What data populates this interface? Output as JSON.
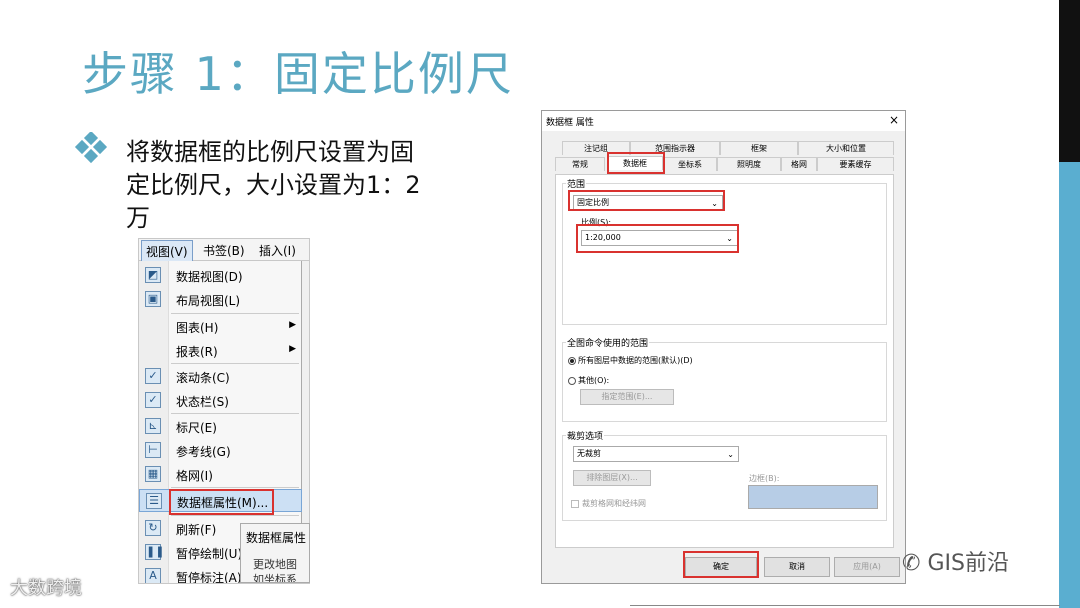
{
  "slide": {
    "title": "步骤 1：固定比例尺",
    "bullet": "将数据框的比例尺设置为固定比例尺，大小设置为1：2万"
  },
  "menu": {
    "menubar": [
      "视图(V)",
      "书签(B)",
      "插入(I)"
    ],
    "items": [
      {
        "label": "数据视图(D)",
        "icon": "data-view-icon"
      },
      {
        "label": "布局视图(L)",
        "icon": "layout-view-icon"
      },
      {
        "label": "图表(H)",
        "has_submenu": true
      },
      {
        "label": "报表(R)",
        "has_submenu": true
      },
      {
        "label": "滚动条(C)",
        "checked": true
      },
      {
        "label": "状态栏(S)",
        "checked": true
      },
      {
        "label": "标尺(E)",
        "icon": "ruler-icon"
      },
      {
        "label": "参考线(G)",
        "icon": "guide-icon"
      },
      {
        "label": "格网(I)",
        "icon": "grid-icon"
      },
      {
        "label": "数据框属性(M)...",
        "icon": "data-frame-properties-icon",
        "highlighted": true
      },
      {
        "label": "刷新(F)",
        "icon": "refresh-icon"
      },
      {
        "label": "暂停绘制(U)",
        "icon": "pause-icon"
      },
      {
        "label": "暂停标注(A)",
        "icon": "pause-label-icon"
      }
    ],
    "submenu": {
      "title": "数据框属性",
      "line1": "更改地图",
      "line2": "如坐标系"
    }
  },
  "dialog": {
    "title": "数据框 属性",
    "close": "×",
    "tabs_row1": [
      "注记组",
      "范围指示器",
      "框架",
      "大小和位置"
    ],
    "tabs_row2": [
      "常规",
      "数据框",
      "坐标系",
      "照明度",
      "格网",
      "要素缓存"
    ],
    "active_tab": "数据框",
    "extent_group": "范围",
    "extent_mode": "固定比例",
    "scale_label": "比例(S):",
    "scale_value": "1:20,000",
    "full_extent_group": "全图命令使用的范围",
    "radio_all_layers": "所有图层中数据的范围(默认)(D)",
    "radio_other": "其他(O):",
    "btn_specify_extent": "指定范围(E)...",
    "clip_group": "裁剪选项",
    "clip_value": "无裁剪",
    "btn_exclude_layers": "排除图层(X)...",
    "border_label": "边框(B):",
    "chk_clip_grid": "裁剪格网和经纬网",
    "btn_ok": "确定",
    "btn_cancel": "取消",
    "btn_apply": "应用(A)"
  },
  "watermarks": {
    "left": "大数跨境",
    "right": "GIS前沿"
  },
  "colors": {
    "title": "#5ba8c2",
    "accent_bar": "#5aaed0",
    "highlight_box": "#d9322f"
  }
}
